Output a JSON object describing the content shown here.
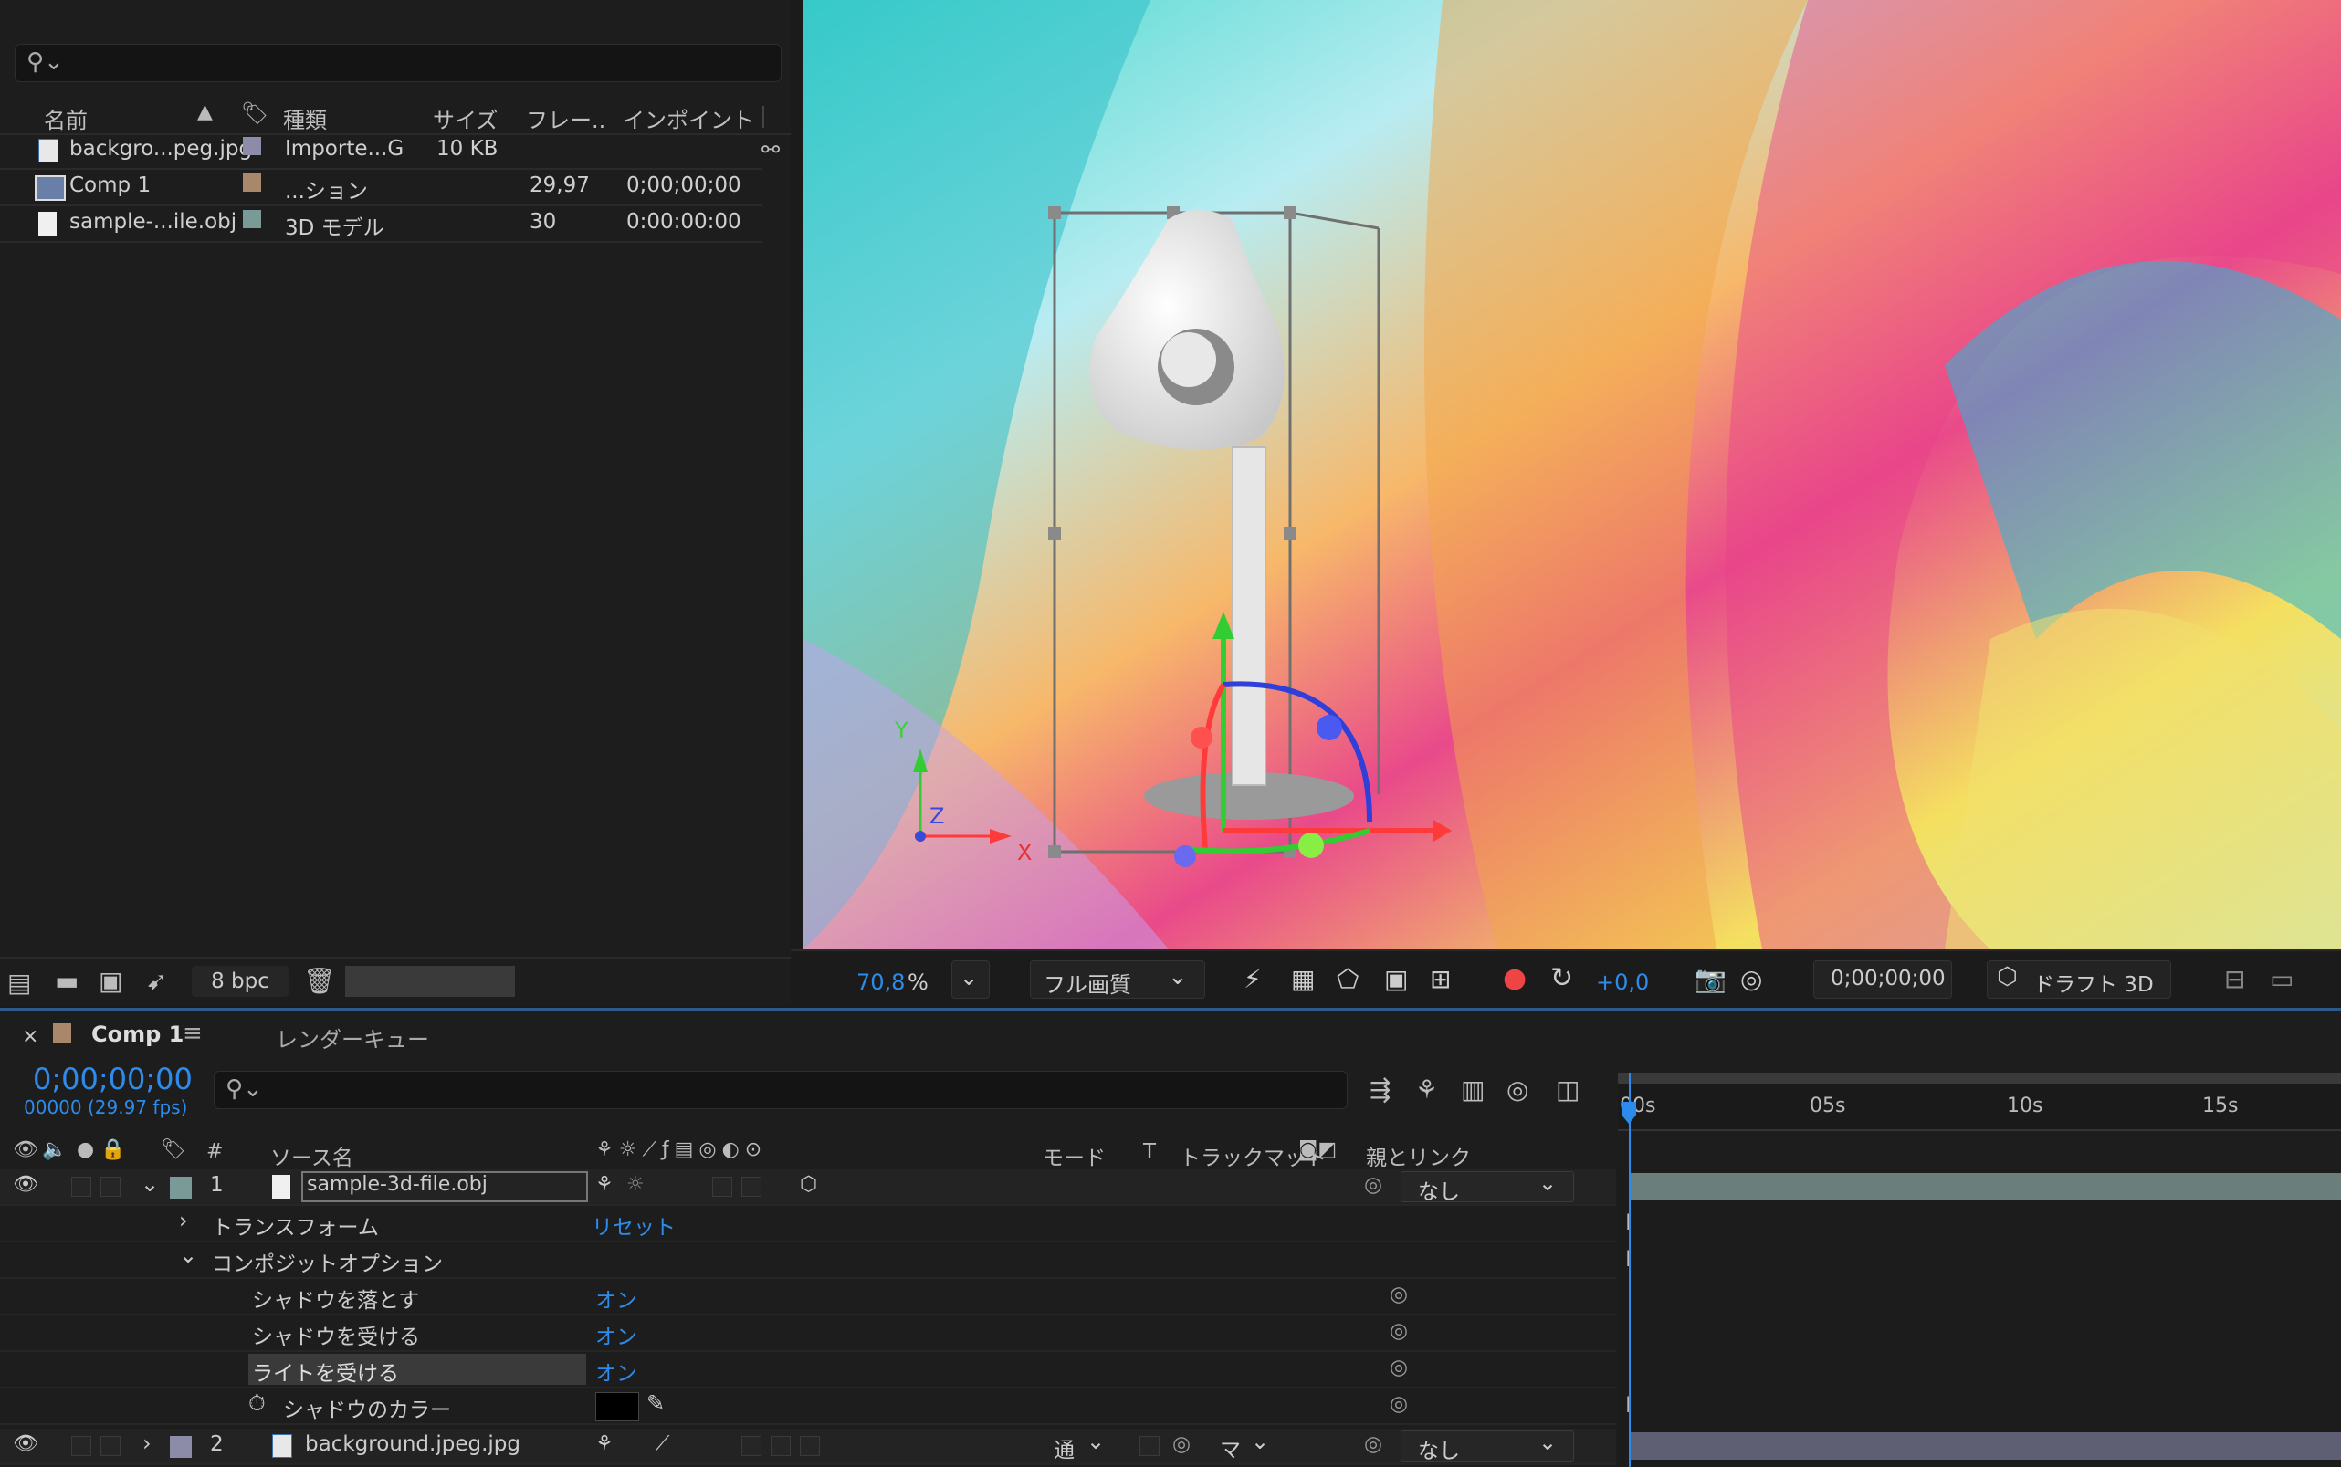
{
  "project": {
    "columns": {
      "name": "名前",
      "type": "種類",
      "size": "サイズ",
      "frame": "フレー..",
      "inpoint": "インポイント"
    },
    "items": [
      {
        "name": "backgro...peg.jpg",
        "type": "Importe...G",
        "size": "10 KB",
        "frame": "",
        "inpoint": "",
        "color": "#8c8ca8",
        "icon": "image-file-icon"
      },
      {
        "name": "Comp 1",
        "type": "...ション",
        "size": "",
        "frame": "29,97",
        "inpoint": "0;00;00;00",
        "color": "#a8876a",
        "icon": "composition-icon"
      },
      {
        "name": "sample-...ile.obj",
        "type": "3D モデル",
        "size": "",
        "frame": "30",
        "inpoint": "0:00:00:00",
        "color": "#7a9a98",
        "icon": "3d-model-file-icon"
      }
    ],
    "bit_depth": "8 bpc"
  },
  "viewer": {
    "zoom": "70,8",
    "zoom_unit": "%",
    "quality": "フル画質",
    "exposure": "+0,0",
    "timecode": "0;00;00;00",
    "draft3d": "ドラフト 3D",
    "axis_labels": {
      "x": "X",
      "y": "Y",
      "z": "Z"
    }
  },
  "timeline": {
    "tab_name": "Comp 1",
    "render_queue": "レンダーキュー",
    "current_time": "0;00;00;00",
    "frame_info": "00000 (29.97 fps)",
    "ruler": [
      "00s",
      "05s",
      "10s",
      "15s"
    ],
    "columns": {
      "hash": "#",
      "source": "ソース名",
      "mode": "モード",
      "t": "T",
      "trackmatte": "トラックマット",
      "parent": "親とリンク"
    },
    "layers": [
      {
        "index": "1",
        "name": "sample-3d-file.obj",
        "parent": "なし",
        "color": "#7a9a98"
      },
      {
        "index": "2",
        "name": "background.jpeg.jpg",
        "mode": "通",
        "matte": "マ",
        "parent": "なし",
        "color": "#8c8ca8"
      }
    ],
    "props": {
      "transform": "トランスフォーム",
      "reset": "リセット",
      "composite": "コンポジットオプション",
      "cast_shadow": "シャドウを落とす",
      "receive_shadow": "シャドウを受ける",
      "receive_light": "ライトを受ける",
      "shadow_color": "シャドウのカラー",
      "on": "オン"
    }
  }
}
